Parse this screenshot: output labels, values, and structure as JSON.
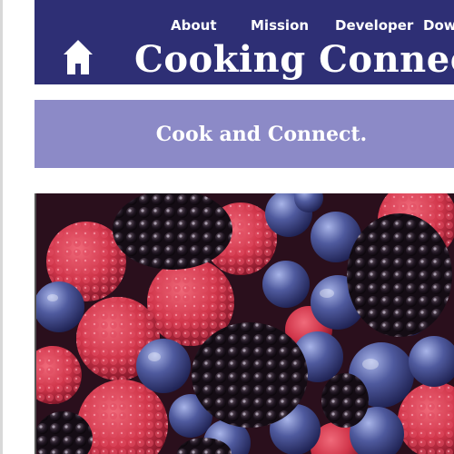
{
  "nav": {
    "items": [
      {
        "label": "About"
      },
      {
        "label": "Mission"
      },
      {
        "label": "Developer"
      },
      {
        "label": "Down"
      }
    ]
  },
  "brand": {
    "title": "Cooking Connect"
  },
  "banner": {
    "tagline": "Cook and Connect."
  },
  "colors": {
    "header_bg": "#2e2f75",
    "banner_bg": "#8c8ac7",
    "text": "#ffffff"
  },
  "icons": {
    "home": "house-icon"
  }
}
